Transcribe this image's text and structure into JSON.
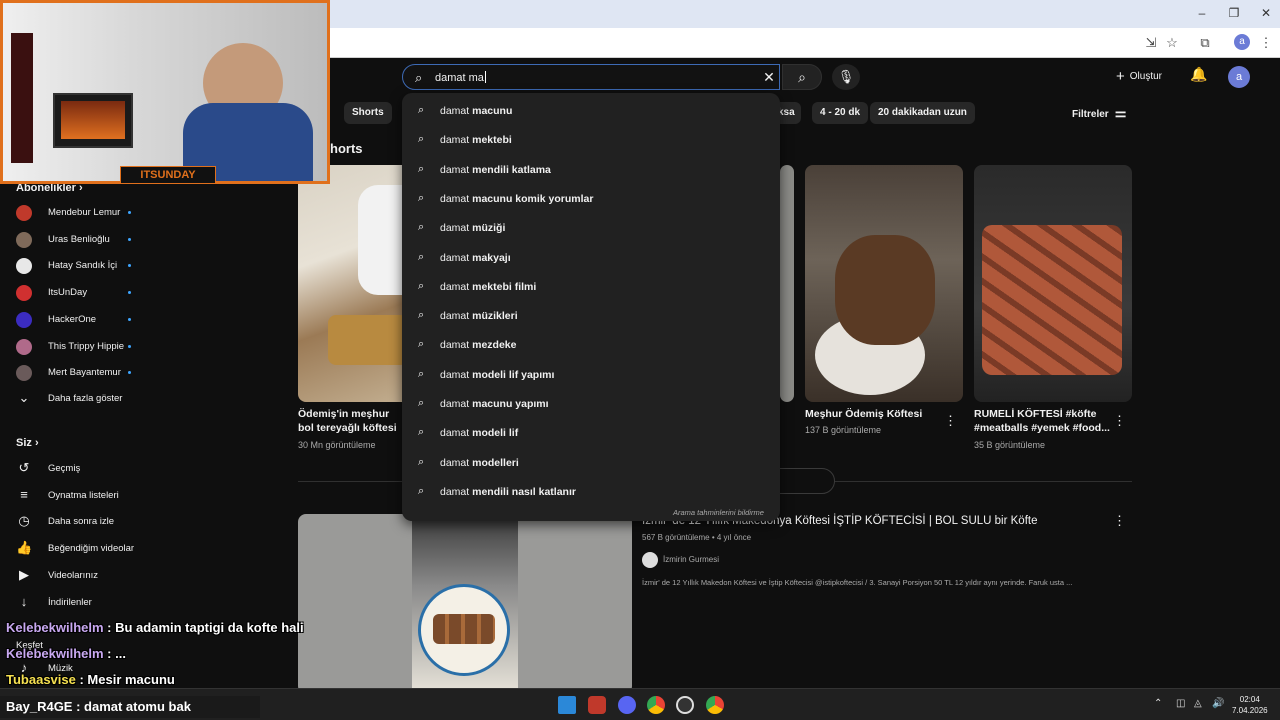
{
  "window": {
    "controls": [
      "–",
      "❐",
      "✕"
    ]
  },
  "browser": {
    "profile_initial": "a"
  },
  "header": {
    "search_query": "damat ma",
    "create_label": "Oluştur",
    "avatar_initial": "a"
  },
  "chips": [
    {
      "label": "Shorts"
    },
    {
      "label": "ksa"
    },
    {
      "label": "4 - 20 dk"
    },
    {
      "label": "20 dakikadan uzun"
    }
  ],
  "filters_label": "Filtreler",
  "suggestions": [
    {
      "prefix": "damat ",
      "rest": "macunu"
    },
    {
      "prefix": "damat ",
      "rest": "mektebi"
    },
    {
      "prefix": "damat ",
      "rest": "mendili katlama"
    },
    {
      "prefix": "damat ",
      "rest": "macunu komik yorumlar"
    },
    {
      "prefix": "damat ",
      "rest": "müziği"
    },
    {
      "prefix": "damat ",
      "rest": "makyajı"
    },
    {
      "prefix": "damat ",
      "rest": "mektebi filmi"
    },
    {
      "prefix": "damat ",
      "rest": "müzikleri"
    },
    {
      "prefix": "damat ",
      "rest": "mezdeke"
    },
    {
      "prefix": "damat ",
      "rest": "modeli lif yapımı"
    },
    {
      "prefix": "damat ",
      "rest": "macunu yapımı"
    },
    {
      "prefix": "damat ",
      "rest": "modeli lif"
    },
    {
      "prefix": "damat ",
      "rest": "modelleri"
    },
    {
      "prefix": "damat ",
      "rest": "mendili nasıl katlanır"
    }
  ],
  "suggestions_report": "Arama tahminlerini bildirme",
  "sidebar": {
    "subscriptions_label": "Abonelikler",
    "channels": [
      {
        "name": "Mendebur Lemur",
        "color": "#c0392b"
      },
      {
        "name": "Uras Benlioğlu",
        "color": "#7f6a5a"
      },
      {
        "name": "Hatay Sandık İçi",
        "color": "#e8e8e8"
      },
      {
        "name": "ItsUnDay",
        "color": "#d03030"
      },
      {
        "name": "HackerOne",
        "color": "#3b2cc0"
      },
      {
        "name": "This Trippy Hippie",
        "color": "#b06a8a"
      },
      {
        "name": "Mert Bayantemur",
        "color": "#6a5a5a"
      }
    ],
    "show_more": "Daha fazla göster",
    "you_label": "Siz",
    "you_items": [
      {
        "label": "Geçmiş",
        "icon": "history-icon",
        "glyph": "↺"
      },
      {
        "label": "Oynatma listeleri",
        "icon": "playlist-icon",
        "glyph": "≡"
      },
      {
        "label": "Daha sonra izle",
        "icon": "clock-icon",
        "glyph": "◷"
      },
      {
        "label": "Beğendiğim videolar",
        "icon": "thumbs-up-icon",
        "glyph": "👍"
      },
      {
        "label": "Videolarınız",
        "icon": "video-icon",
        "glyph": "▶"
      },
      {
        "label": "İndirilenler",
        "icon": "download-icon",
        "glyph": "↓"
      }
    ],
    "explore_label": "Keşfet",
    "music_label": "Müzik"
  },
  "content": {
    "shorts_heading": "horts",
    "shorts": [
      {
        "title": "Ödemiş'in meşhur bol tereyağlı köftesi ...",
        "views": "30 Mn görüntüleme"
      },
      {
        "title": "Meşhur Ödemiş Köftesi",
        "views": "137 B görüntüleme"
      },
      {
        "title": "RUMELİ KÖFTESİ #köfte #meatballs #yemek #food...",
        "views": "35 B görüntüleme"
      }
    ],
    "video": {
      "title": "İzmir' de 12 Yıllık Makedonya Köftesi İŞTİP KÖFTECİSİ | BOL SULU bir Köfte",
      "sub": "567 B görüntüleme • 4 yıl önce",
      "channel": "İzmirin Gurmesi",
      "desc": "İzmir' de 12 Yıllık Makedon Köftesi ve İştip Köftecisi @istipkoftecisi / 3. Sanayi Porsiyon 50 TL 12 yıldır aynı yerinde. Faruk usta ..."
    }
  },
  "webcam_tag": "ITSUNDAY",
  "chat": [
    {
      "user": "Kelebekwilhelm",
      "msg": ": Bu adamin taptigi da kofte hali"
    },
    {
      "user": "Kelebekwilhelm",
      "msg": ": ..."
    },
    {
      "user": "Tubaasvise",
      "msg": ": Mesir macunu"
    }
  ],
  "stream_msg": "Bay_R4GE : damat atomu bak",
  "taskbar": {
    "time": "02:04",
    "date": "7.04.2026"
  }
}
